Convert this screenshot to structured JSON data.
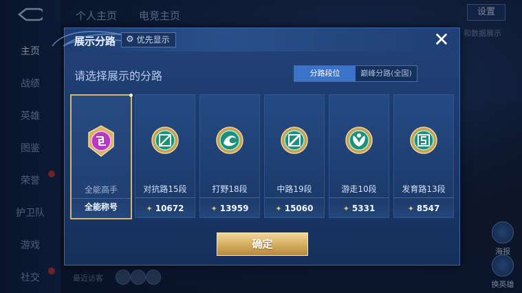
{
  "background": {
    "sidebar": [
      {
        "label": "主页",
        "active": true
      },
      {
        "label": "战绩"
      },
      {
        "label": "英雄"
      },
      {
        "label": "图鉴"
      },
      {
        "label": "荣誉"
      },
      {
        "label": "护卫队"
      },
      {
        "label": "游戏"
      },
      {
        "label": "社交"
      }
    ],
    "top_tabs": [
      "个人主页",
      "电竞主页"
    ],
    "settings_label": "设置",
    "right_text": "和数据展示",
    "side_buttons": [
      "海报",
      "换英雄"
    ],
    "recent_visit": "最近访客"
  },
  "modal": {
    "title": "展示分路",
    "priority_label": "优先显示",
    "close_icon": "close-icon",
    "subtitle": "请选择展示的分路",
    "toggle": [
      {
        "label": "分路段位",
        "active": true
      },
      {
        "label": "巅峰分路(全国)",
        "active": false
      }
    ],
    "cards": [
      {
        "name": "全能高手",
        "footer": "全能称号",
        "selected": true,
        "color": "#b83ac0"
      },
      {
        "name": "对抗路15段",
        "score": "10672",
        "color": "#21a88f"
      },
      {
        "name": "打野18段",
        "score": "13959",
        "color": "#21a88f"
      },
      {
        "name": "中路19段",
        "score": "15060",
        "color": "#21a88f"
      },
      {
        "name": "游走10段",
        "score": "5331",
        "color": "#21a88f"
      },
      {
        "name": "发育路13段",
        "score": "8547",
        "color": "#21a88f"
      }
    ],
    "confirm_label": "确定"
  },
  "colors": {
    "accent_gold": "#d4ab5c",
    "toggle_active": "#3a73c9",
    "panel": "#1a3868"
  }
}
